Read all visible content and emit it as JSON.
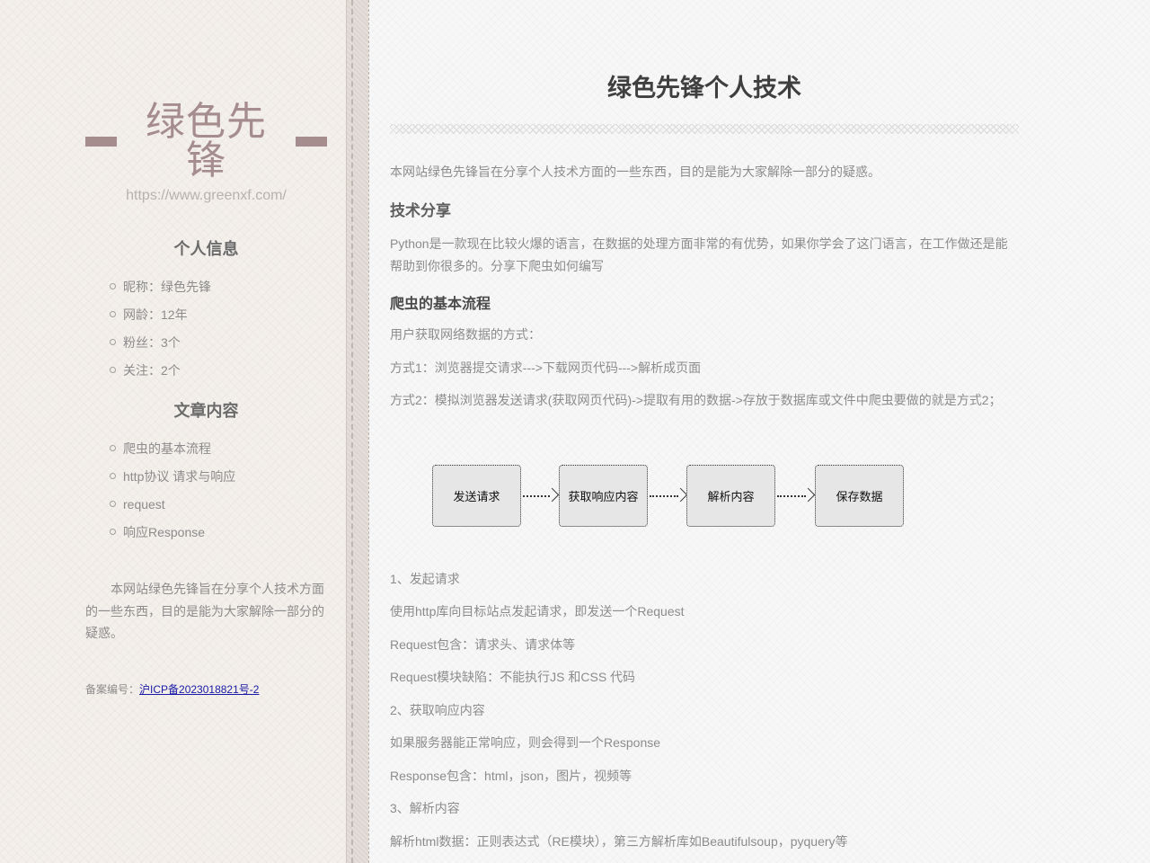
{
  "sidebar": {
    "brand_title": "绿色先锋",
    "brand_url": "https://www.greenxf.com/",
    "personal_info_title": "个人信息",
    "personal_info": [
      "昵称：绿色先锋",
      "网龄：12年",
      "粉丝：3个",
      "关注：2个"
    ],
    "articles_title": "文章内容",
    "articles": [
      "爬虫的基本流程",
      "http协议 请求与响应",
      "request",
      "响应Response"
    ],
    "about": "本网站绿色先锋旨在分享个人技术方面的一些东西，目的是能为大家解除一部分的疑惑。",
    "icp_label": "备案编号：",
    "icp_link": "沪ICP备2023018821号-2"
  },
  "main": {
    "title": "绿色先锋个人技术",
    "intro": "本网站绿色先锋旨在分享个人技术方面的一些东西，目的是能为大家解除一部分的疑惑。",
    "section_tech": "技术分享",
    "python_intro": "Python是一款现在比较火爆的语言，在数据的处理方面非常的有优势，如果你学会了这门语言，在工作做还是能帮助到你很多的。分享下爬虫如何编写",
    "section_flow": "爬虫的基本流程",
    "ways_intro": "用户获取网络数据的方式：",
    "way1": "方式1：浏览器提交请求--->下载网页代码--->解析成页面",
    "way2": "方式2：模拟浏览器发送请求(获取网页代码)->提取有用的数据->存放于数据库或文件中爬虫要做的就是方式2；",
    "diagram": [
      "发送请求",
      "获取响应内容",
      "解析内容",
      "保存数据"
    ],
    "steps": [
      "1、发起请求",
      "使用http库向目标站点发起请求，即发送一个Request",
      "Request包含：请求头、请求体等",
      "Request模块缺陷：不能执行JS 和CSS 代码",
      "2、获取响应内容",
      "如果服务器能正常响应，则会得到一个Response",
      "Response包含：html，json，图片，视频等",
      "3、解析内容",
      "解析html数据：正则表达式（RE模块），第三方解析库如Beautifulsoup，pyquery等"
    ]
  },
  "colors": {
    "brand": "#a68d8d",
    "text": "#8c8c8c",
    "heading": "#5e5e5e",
    "link": "#1a1aa6"
  }
}
